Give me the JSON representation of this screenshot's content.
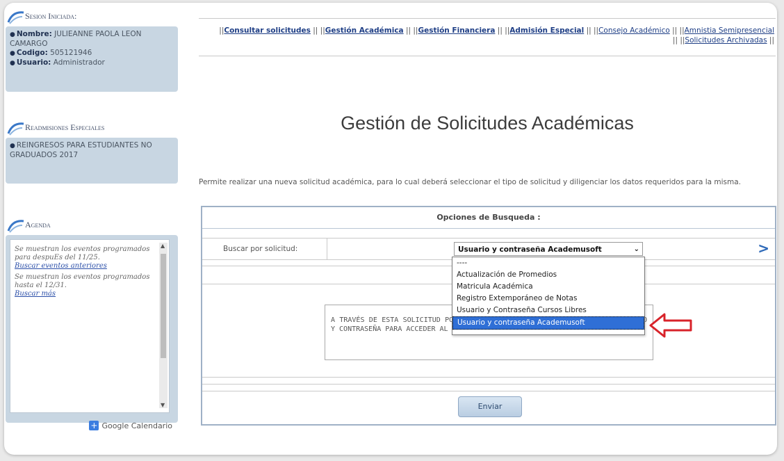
{
  "sidebar": {
    "session": {
      "title": "Sesion Iniciada:",
      "name_label": "Nombre:",
      "name_value": "JULIEANNE PAOLA LEON CAMARGO",
      "code_label": "Codigo:",
      "code_value": "505121946",
      "user_label": "Usuario:",
      "user_value": "Administrador"
    },
    "special": {
      "title": "Readmisiones Especiales",
      "item": "REINGRESOS PARA ESTUDIANTES NO GRADUADOS 2017"
    },
    "agenda": {
      "title": "Agenda",
      "text1": "Se muestran los eventos programados para despuEs del 11/25.",
      "link1": "Buscar eventos anteriores",
      "text2": "Se muestran los eventos programados hasta el 12/31.",
      "link2": "Buscar más",
      "calendar_label": "Google Calendario"
    }
  },
  "nav": {
    "consultar": "Consultar solicitudes",
    "gestion_academica": "Gestión Académica",
    "gestion_financiera": "Gestión Financiera",
    "admision_especial": "Admisión Especial",
    "consejo_academico": "Consejo Académico",
    "amnistia": "Amnistia Semipresencial",
    "archivadas": "Solicitudes Archivadas",
    "sep": "||"
  },
  "main": {
    "title": "Gestión de Solicitudes Académicas",
    "description": "Permite realizar una nueva solicitud académica, para lo cual deberá seleccionar el tipo de solicitud y diligenciar los datos requeridos para la misma."
  },
  "form": {
    "header": "Opciones de Busqueda :",
    "search_label": "Buscar por solicitud:",
    "selected": "Usuario y contraseña Academusoft",
    "options": [
      "----",
      "Actualización de Promedios",
      "Matricula Académica",
      "Registro Extemporáneo de Notas",
      "Usuario y Contraseña Cursos Libres",
      "Usuario y contraseña Academusoft"
    ],
    "info_text": "A TRAVÉS DE ESTA SOLICITUD PODRÁ REALIZAR EL RESTABLECIMIENTO DE SU USUARIO Y CONTRASEÑA PARA ACCEDER AL SISTEMA ACADEMUSOFT.",
    "submit": "Enviar"
  },
  "colors": {
    "accent": "#2f6fd6",
    "sidebar_panel": "#c8d6e2",
    "arrow": "#d8232a",
    "link": "#1f3f86"
  }
}
